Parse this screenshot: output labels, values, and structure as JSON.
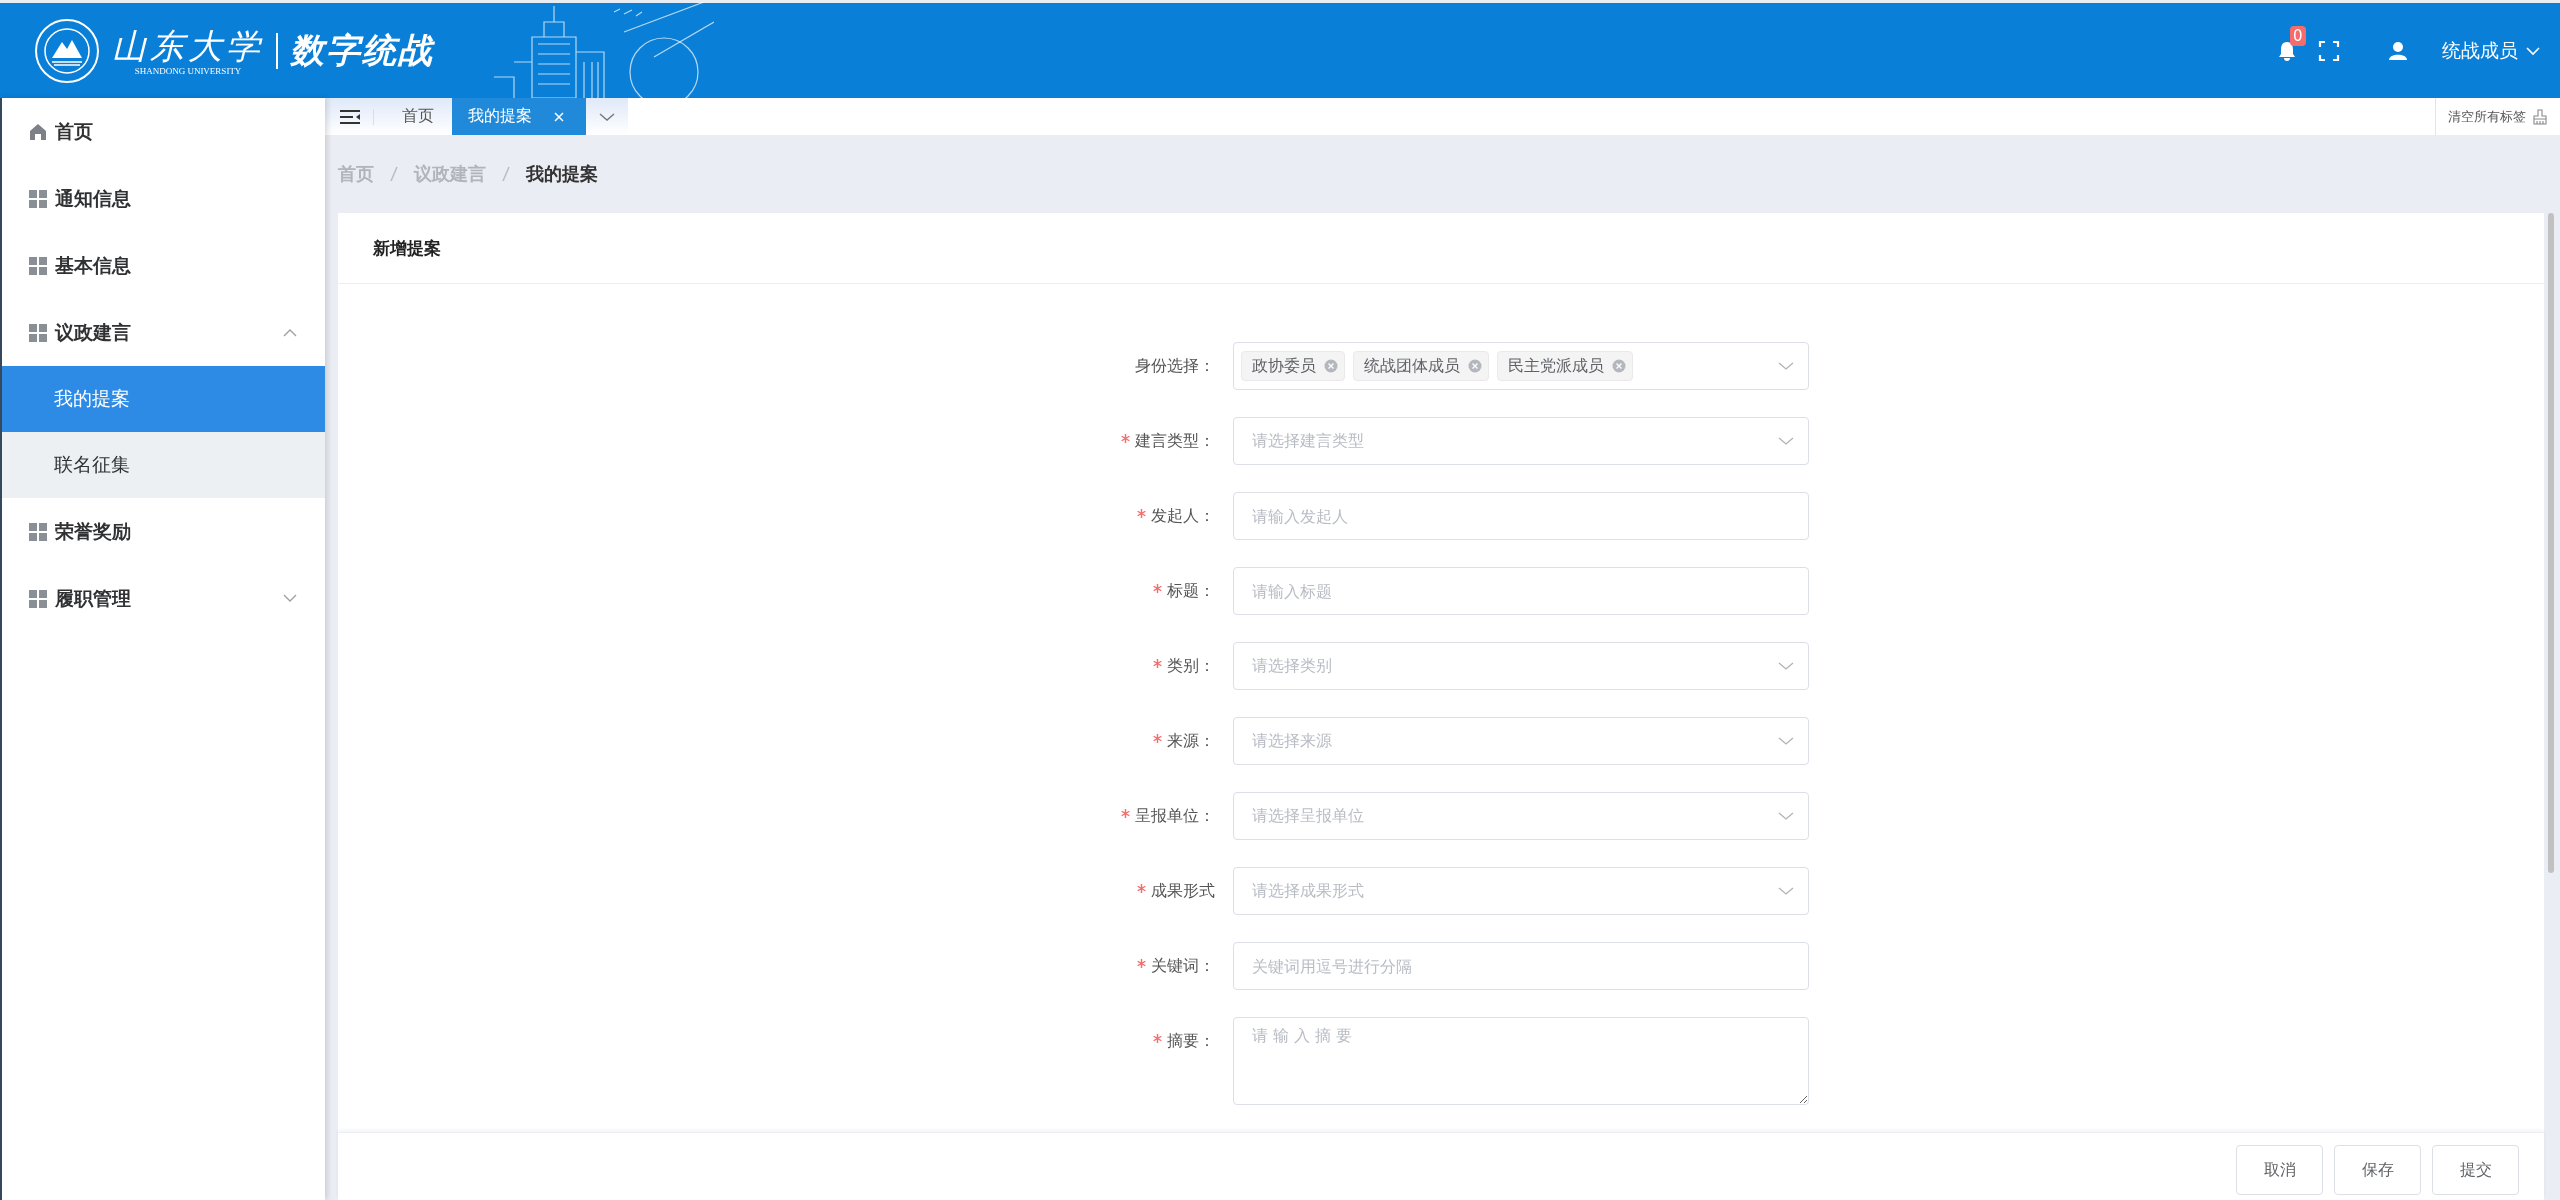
{
  "header": {
    "logo_text": "山东大学",
    "logo_subtext": "SHANDONG UNIVERSITY",
    "app_title": "数字统战",
    "notification_count": "0",
    "user_name": "统战成员"
  },
  "sidebar": {
    "items": [
      {
        "label": "首页",
        "kind": "home",
        "selected": false
      },
      {
        "label": "通知信息",
        "kind": "module",
        "selected": false
      },
      {
        "label": "基本信息",
        "kind": "module",
        "selected": false
      },
      {
        "label": "议政建言",
        "kind": "module",
        "selected": false,
        "expanded": true,
        "children": [
          {
            "label": "我的提案",
            "selected": true
          },
          {
            "label": "联名征集",
            "selected": false
          }
        ]
      },
      {
        "label": "荣誉奖励",
        "kind": "module",
        "selected": false
      },
      {
        "label": "履职管理",
        "kind": "module",
        "selected": false,
        "expanded": false
      }
    ]
  },
  "tabs": [
    {
      "label": "首页",
      "selected": false,
      "closable": false
    },
    {
      "label": "我的提案",
      "selected": true,
      "closable": true
    }
  ],
  "clear_tabs": "清空所有标签",
  "breadcrumb": [
    "首页",
    "议政建言",
    "我的提案"
  ],
  "card": {
    "title": "新增提案"
  },
  "form": {
    "fields": [
      {
        "label": "身份选择：",
        "required": false,
        "kind": "tags",
        "tags": [
          "政协委员",
          "统战团体成员",
          "民主党派成员"
        ]
      },
      {
        "label": "建言类型：",
        "required": true,
        "kind": "select",
        "placeholder": "请选择建言类型"
      },
      {
        "label": "发起人：",
        "required": true,
        "kind": "input",
        "placeholder": "请输入发起人"
      },
      {
        "label": "标题：",
        "required": true,
        "kind": "input",
        "placeholder": "请输入标题"
      },
      {
        "label": "类别：",
        "required": true,
        "kind": "select",
        "placeholder": "请选择类别"
      },
      {
        "label": "来源：",
        "required": true,
        "kind": "select",
        "placeholder": "请选择来源"
      },
      {
        "label": "呈报单位：",
        "required": true,
        "kind": "select",
        "placeholder": "请选择呈报单位"
      },
      {
        "label": "成果形式",
        "required": true,
        "kind": "select",
        "placeholder": "请选择成果形式"
      },
      {
        "label": "关键词：",
        "required": true,
        "kind": "input",
        "placeholder": "关键词用逗号进行分隔"
      },
      {
        "label": "摘要：",
        "required": true,
        "kind": "textarea",
        "placeholder": "请 输 入 摘 要"
      }
    ]
  },
  "buttons": [
    "取消",
    "保存",
    "提交"
  ]
}
